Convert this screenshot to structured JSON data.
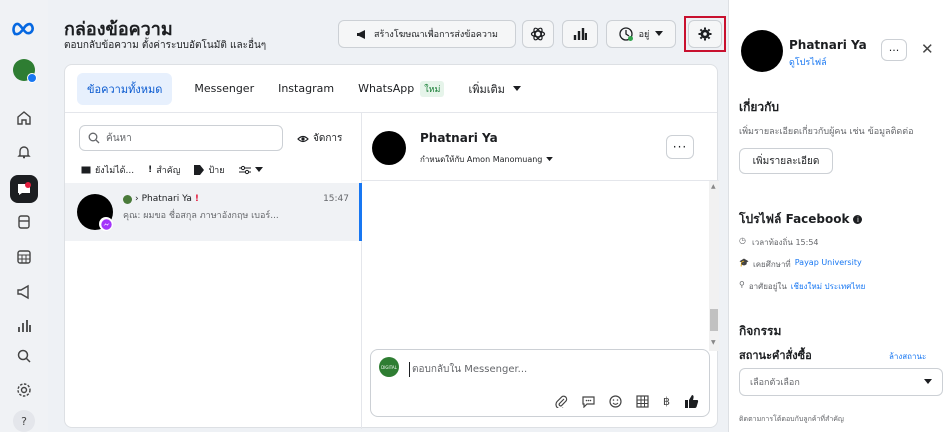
{
  "header": {
    "title": "กล่องข้อความ",
    "subtitle": "ตอบกลับข้อความ ตั้งค่าระบบอัตโนมัติ และอื่นๆ",
    "create_ad_label": "สร้างโฆษณาเพื่อการส่งข้อความ",
    "status_label": "อยู่"
  },
  "tabs": [
    {
      "label": "ข้อความทั้งหมด"
    },
    {
      "label": "Messenger"
    },
    {
      "label": "Instagram"
    },
    {
      "label": "WhatsApp",
      "badge": "ใหม่"
    },
    {
      "label": "เพิ่มเติม"
    }
  ],
  "list": {
    "search_placeholder": "ค้นหา",
    "manage_label": "จัดการ",
    "filters": [
      "ยังไม่ได้...",
      "สำคัญ",
      "ป้าย"
    ],
    "conversations": [
      {
        "name": "Phatnari Ya",
        "time": "15:47",
        "preview": "คุณ: ผมขอ ชื่อสกุล ภาษาอังกฤษ เบอร์..."
      }
    ]
  },
  "chat": {
    "name": "Phatnari Ya",
    "assigned": "กำหนดให้กับ Amon Manomuang",
    "composer_placeholder": "ตอบกลับใน Messenger...",
    "page_avatar_text": "DIGITAL"
  },
  "profile": {
    "name": "Phatnari Ya",
    "view_profile": "ดูโปรไฟล์",
    "about_title": "เกี่ยวกับ",
    "about_desc": "เพิ่มรายละเอียดเกี่ยวกับผู้คน เช่น ข้อมูลติดต่อ",
    "add_details": "เพิ่มรายละเอียด",
    "fb_profile_title": "โปรไฟล์ Facebook",
    "local_time": "เวลาท้องถิ่น 15:54",
    "studied_prefix": "เคยศึกษาที่",
    "studied_place": "Payap University",
    "lives_prefix": "อาศัยอยู่ใน",
    "lives_place": "เชียงใหม่ ประเทศไทย",
    "activity_title": "กิจกรรม",
    "order_status_title": "สถานะคำสั่งซื้อ",
    "clear_status": "ล้างสถานะ",
    "select_placeholder": "เลือกตัวเลือก",
    "footer_note": "ติดตามการโต้ตอบกับลูกค้าที่สำคัญ"
  },
  "colors": {
    "accent": "#1877f2",
    "highlight": "#c8102e",
    "brand_blue": "#0668e1"
  }
}
